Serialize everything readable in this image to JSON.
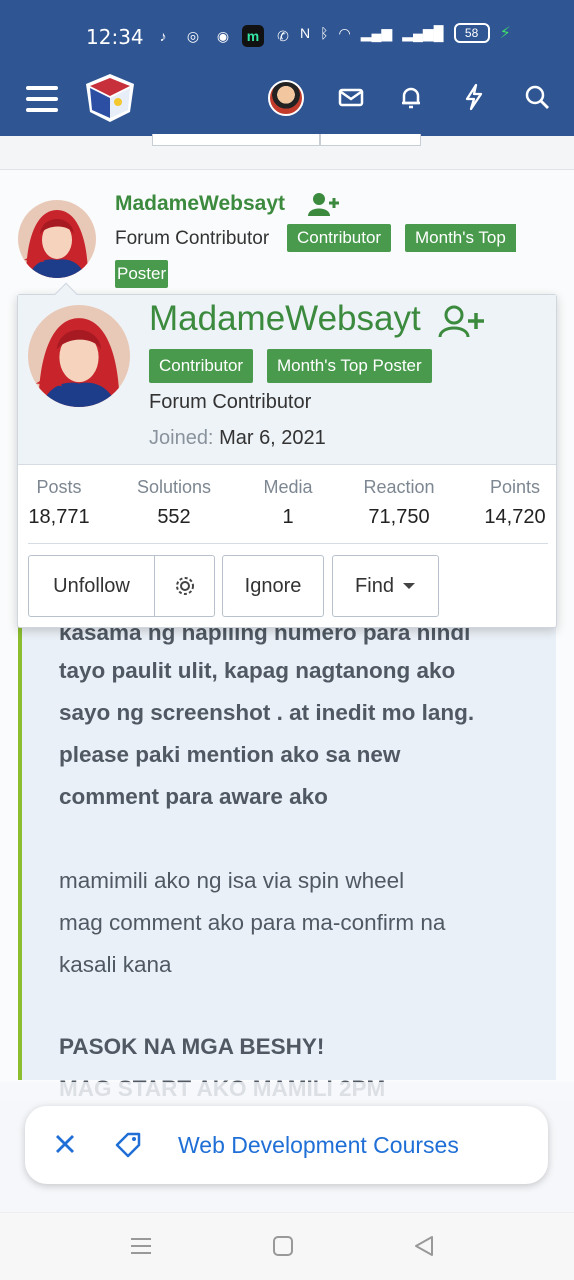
{
  "status_bar": {
    "time": "12:34",
    "battery": "58"
  },
  "nav": {
    "menu_icon": "hamburger-icon",
    "logo": "site-logo",
    "icons": [
      "envelope-icon",
      "bell-icon",
      "lightning-icon",
      "search-icon"
    ]
  },
  "post": {
    "author": "MadameWebsayt",
    "user_title": "Forum Contributor",
    "badges": [
      "Contributor",
      "Month's Top",
      "Poster"
    ],
    "quote_bold_lines": [
      "kasama ng napiling numero para hindi",
      "tayo paulit ulit, kapag nagtanong ako",
      "sayo ng screenshot . at inedit mo lang.",
      "please paki mention ako sa new",
      "comment para aware ako"
    ],
    "quote_lines": [
      "mamimili ako ng isa via spin wheel",
      "mag comment ako para ma-confirm na",
      "kasali kana"
    ],
    "quote_bold_footer": [
      "PASOK NA MGA BESHY!",
      "MAG START AKO MAMILI 2PM"
    ]
  },
  "member_tooltip": {
    "name": "MadameWebsayt",
    "badges": [
      "Contributor",
      "Month's Top Poster"
    ],
    "user_title": "Forum Contributor",
    "joined_label": "Joined:",
    "joined_value": "Mar 6, 2021",
    "stats": [
      {
        "label": "Posts",
        "value": "18,771"
      },
      {
        "label": "Solutions",
        "value": "552"
      },
      {
        "label": "Media",
        "value": "1"
      },
      {
        "label": "Reaction",
        "value": "71,750"
      },
      {
        "label": "Points",
        "value": "14,720"
      }
    ],
    "buttons": {
      "unfollow": "Unfollow",
      "ignore": "Ignore",
      "find": "Find"
    }
  },
  "chip": {
    "text": "Web Development Courses"
  },
  "colors": {
    "header_bg": "#2f5593",
    "username_green": "#3b8a3e",
    "badge_green": "#4a9a4d",
    "link_blue": "#1f6fd6",
    "quote_border": "#8bbd2f"
  }
}
